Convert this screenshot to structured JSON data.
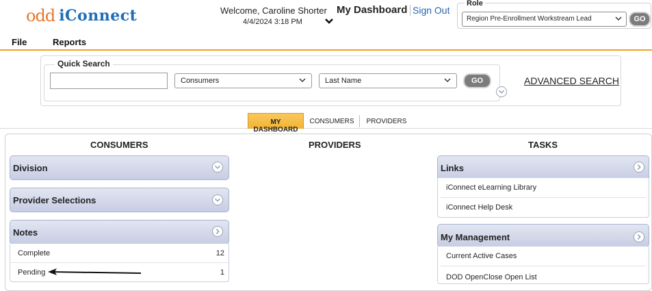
{
  "header": {
    "logo_odd": "odd",
    "logo_iconnect": "iConnect",
    "welcome": "Welcome, Caroline Shorter",
    "datetime": "4/4/2024 3:18 PM",
    "page_title": "My Dashboard",
    "sign_out": "Sign Out",
    "role_label": "Role",
    "role_value": "Region Pre-Enrollment Workstream Lead",
    "go_label": "GO"
  },
  "menu": {
    "file": "File",
    "reports": "Reports"
  },
  "quick_search": {
    "legend": "Quick Search",
    "input_value": "",
    "entity_select": "Consumers",
    "field_select": "Last Name",
    "go_label": "GO",
    "advanced": "ADVANCED SEARCH"
  },
  "tabs": [
    "MY DASHBOARD",
    "CONSUMERS",
    "PROVIDERS"
  ],
  "columns": {
    "consumers": "CONSUMERS",
    "providers": "PROVIDERS",
    "tasks": "TASKS"
  },
  "consumers_panels": {
    "division": "Division",
    "provider_selections": "Provider Selections",
    "notes": {
      "title": "Notes",
      "rows": [
        {
          "label": "Complete",
          "count": "12"
        },
        {
          "label": "Pending",
          "count": "1"
        }
      ]
    }
  },
  "tasks_panels": {
    "links": {
      "title": "Links",
      "items": [
        "iConnect eLearning Library",
        "iConnect Help Desk"
      ]
    },
    "my_management": {
      "title": "My Management",
      "items": [
        "Current Active Cases",
        "DOD OpenClose Open List"
      ]
    }
  },
  "colors": {
    "accent": "#f0a21f",
    "link": "#2566b3",
    "panel": "#c7cde3",
    "logo_orange": "#e8762d",
    "logo_blue": "#1f6db6"
  }
}
